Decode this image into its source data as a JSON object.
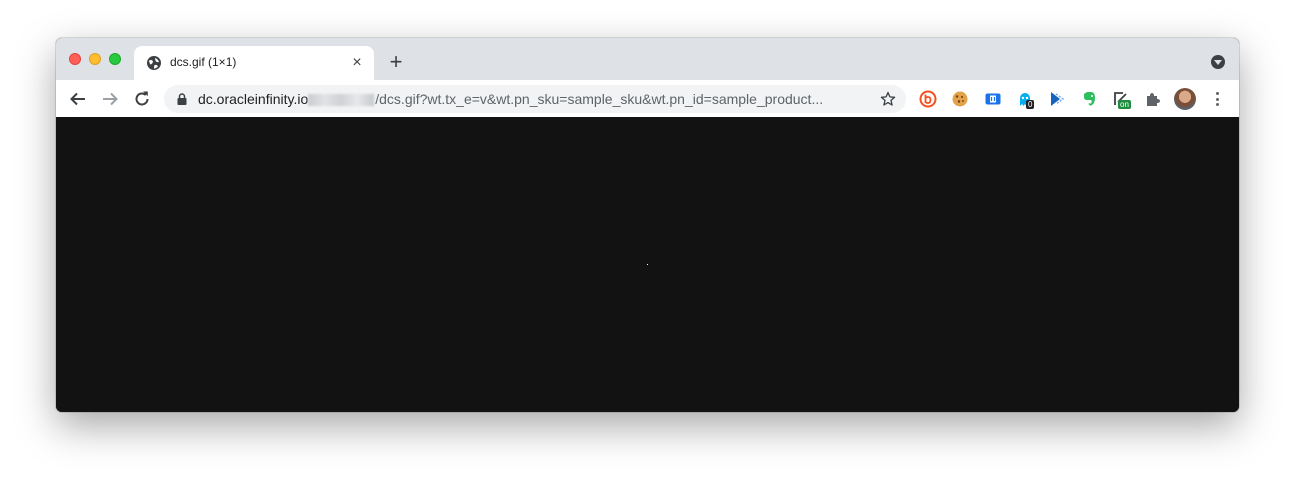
{
  "browser": {
    "tab": {
      "title": "dcs.gif (1×1)",
      "favicon": "globe-icon",
      "close_label": "×"
    },
    "new_tab_label": "+",
    "address_bar": {
      "host": "dc.oracleinfinity.io",
      "path": "/dcs.gif?wt.tx_e=v&wt.pn_sku=sample_sku&wt.pn_id=sample_product...",
      "secure_icon": "lock-icon"
    },
    "extensions": [
      {
        "name": "honey-extension-icon",
        "color": "#f4511e"
      },
      {
        "name": "cookie-extension-icon",
        "color": "#c57b2a"
      },
      {
        "name": "devtools-extension-icon",
        "color": "#1a73e8"
      },
      {
        "name": "ghostery-extension-icon",
        "color": "#00aef0",
        "badge": "0"
      },
      {
        "name": "tag-extension-icon",
        "color": "#1565c0"
      },
      {
        "name": "evernote-extension-icon",
        "color": "#2dbe60"
      },
      {
        "name": "toggle-extension-icon",
        "color": "#3c4043",
        "badge": "on"
      },
      {
        "name": "puzzle-extensions-icon",
        "color": "#5f6368"
      }
    ],
    "colors": {
      "titlebar": "#dee1e6",
      "toolbar": "#ffffff",
      "page_background": "#121212"
    }
  }
}
